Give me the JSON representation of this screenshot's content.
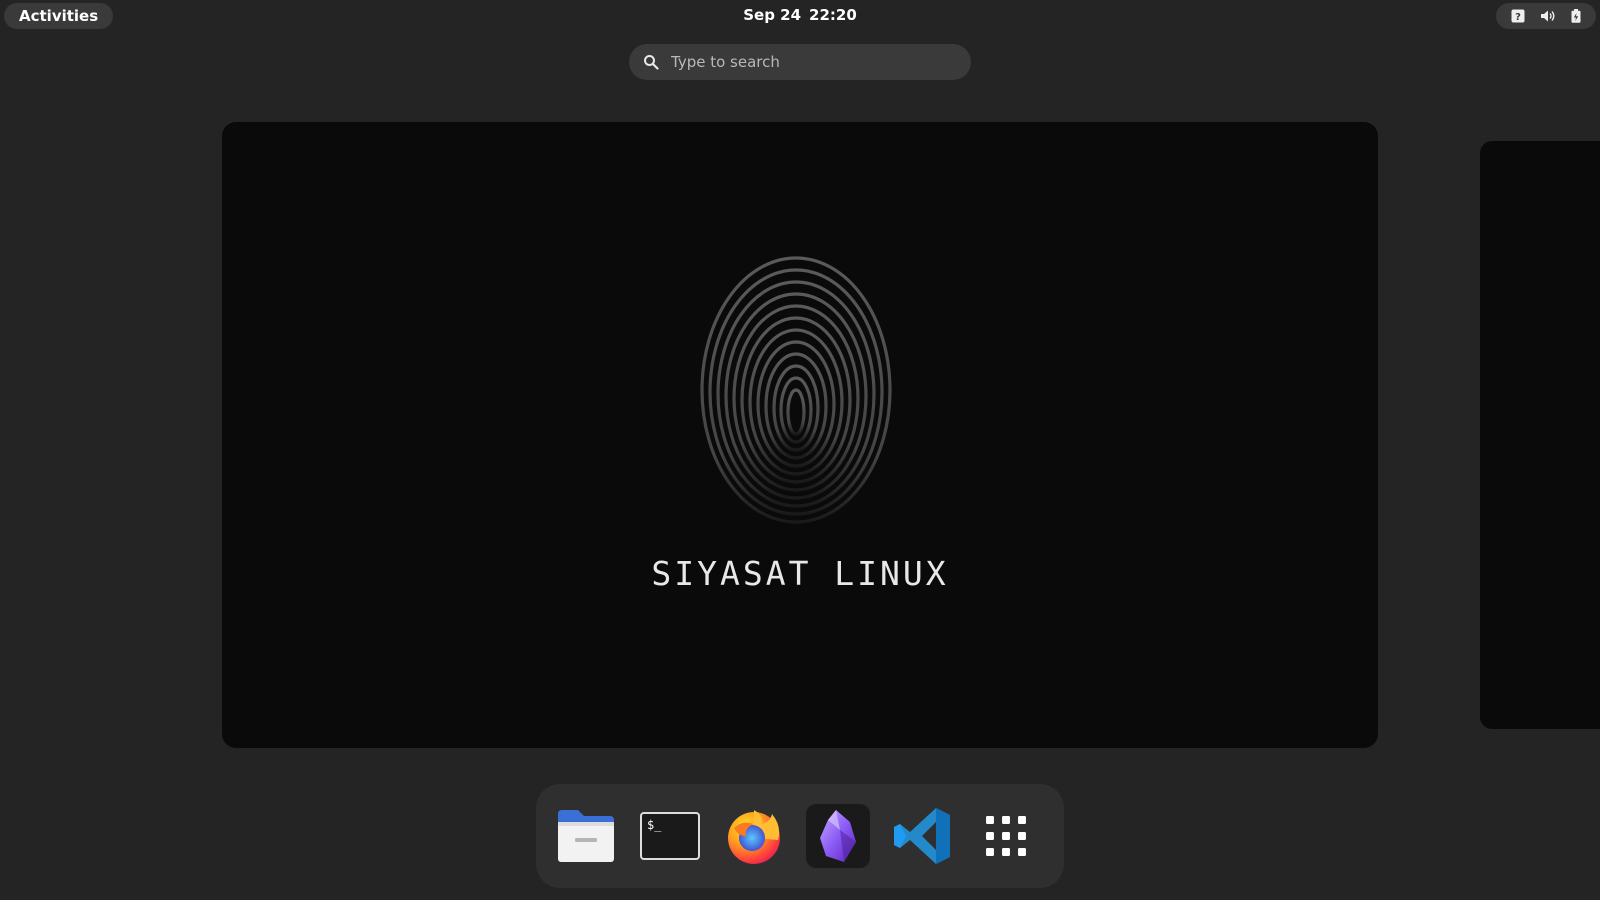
{
  "topbar": {
    "activities_label": "Activities",
    "date": "Sep 24",
    "time": "22:20",
    "tray_icons": [
      "help-icon",
      "volume-icon",
      "battery-icon"
    ]
  },
  "search": {
    "placeholder": "Type to search"
  },
  "workspace": {
    "wallpaper_title": "SIYASAT LINUX"
  },
  "dock": {
    "items": [
      {
        "name": "files",
        "icon": "folder-icon"
      },
      {
        "name": "terminal",
        "icon": "terminal-icon",
        "prompt": "$_"
      },
      {
        "name": "firefox",
        "icon": "firefox-icon"
      },
      {
        "name": "obsidian",
        "icon": "obsidian-icon",
        "active": true
      },
      {
        "name": "vscode",
        "icon": "vscode-icon"
      },
      {
        "name": "show-apps",
        "icon": "app-grid-icon"
      }
    ]
  },
  "colors": {
    "background": "#242424",
    "panel": "#3a3a3a",
    "dock": "#2f2f2f",
    "workspace": "#0a0a0a"
  }
}
